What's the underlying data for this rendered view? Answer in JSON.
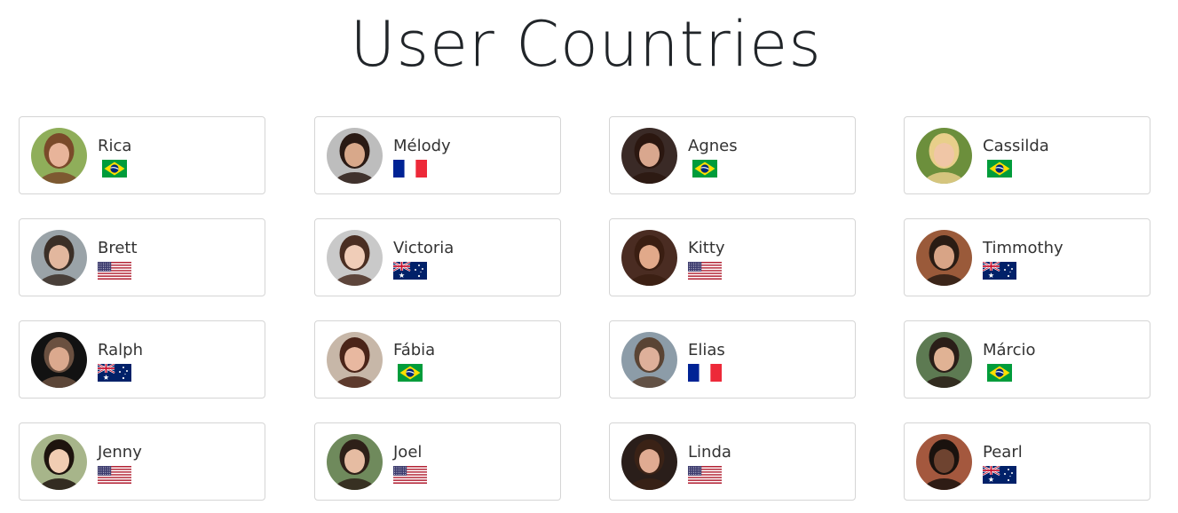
{
  "page": {
    "title": "User Countries"
  },
  "users": [
    {
      "name": "Rica",
      "country": "BR",
      "avatar": {
        "bg": "#8fae5a",
        "skin": "#e8b49a",
        "hair": "#7a4a2a"
      }
    },
    {
      "name": "Mélody",
      "country": "FR",
      "avatar": {
        "bg": "#bdbdbd",
        "skin": "#d8a88a",
        "hair": "#2a1a14"
      }
    },
    {
      "name": "Agnes",
      "country": "BR",
      "avatar": {
        "bg": "#3a2a26",
        "skin": "#d9a78e",
        "hair": "#2b1710"
      }
    },
    {
      "name": "Cassilda",
      "country": "BR",
      "avatar": {
        "bg": "#6c8f3c",
        "skin": "#f0c6a6",
        "hair": "#e8cf8a"
      }
    },
    {
      "name": "Brett",
      "country": "US",
      "avatar": {
        "bg": "#9aa3a8",
        "skin": "#e2b79e",
        "hair": "#3b2f27"
      }
    },
    {
      "name": "Victoria",
      "country": "AU",
      "avatar": {
        "bg": "#c9c9c9",
        "skin": "#f0cdb8",
        "hair": "#4a2e22"
      }
    },
    {
      "name": "Kitty",
      "country": "US",
      "avatar": {
        "bg": "#4a2c22",
        "skin": "#e1a98a",
        "hair": "#3a1e12"
      }
    },
    {
      "name": "Timmothy",
      "country": "AU",
      "avatar": {
        "bg": "#9a5a3a",
        "skin": "#d8a486",
        "hair": "#2a1c14"
      }
    },
    {
      "name": "Ralph",
      "country": "AU",
      "avatar": {
        "bg": "#121212",
        "skin": "#dba98e",
        "hair": "#6a5040"
      }
    },
    {
      "name": "Fábia",
      "country": "BR",
      "avatar": {
        "bg": "#c7b7a8",
        "skin": "#e8b8a0",
        "hair": "#4a2418"
      }
    },
    {
      "name": "Elias",
      "country": "FR",
      "avatar": {
        "bg": "#8c9ca8",
        "skin": "#deb09a",
        "hair": "#5a4434"
      }
    },
    {
      "name": "Márcio",
      "country": "BR",
      "avatar": {
        "bg": "#5d7a52",
        "skin": "#e0b294",
        "hair": "#2a1e18"
      }
    },
    {
      "name": "Jenny",
      "country": "US",
      "avatar": {
        "bg": "#a7b58a",
        "skin": "#f1cdb3",
        "hair": "#1e140e"
      }
    },
    {
      "name": "Joel",
      "country": "US",
      "avatar": {
        "bg": "#6f8a5c",
        "skin": "#e6bca2",
        "hair": "#2e2018"
      }
    },
    {
      "name": "Linda",
      "country": "US",
      "avatar": {
        "bg": "#2a1e1a",
        "skin": "#e0ab92",
        "hair": "#3a2216"
      }
    },
    {
      "name": "Pearl",
      "country": "AU",
      "avatar": {
        "bg": "#a4583e",
        "skin": "#6e4330",
        "hair": "#1a120e"
      }
    }
  ],
  "colors": {
    "fr_blue": "#002395",
    "fr_red": "#ed2939",
    "br_green": "#009c3b",
    "br_yellow": "#ffdf00",
    "br_blue": "#002776",
    "us_red": "#b22234",
    "us_blue": "#3c3b6e",
    "au_blue": "#012169",
    "au_red": "#c8102e"
  }
}
